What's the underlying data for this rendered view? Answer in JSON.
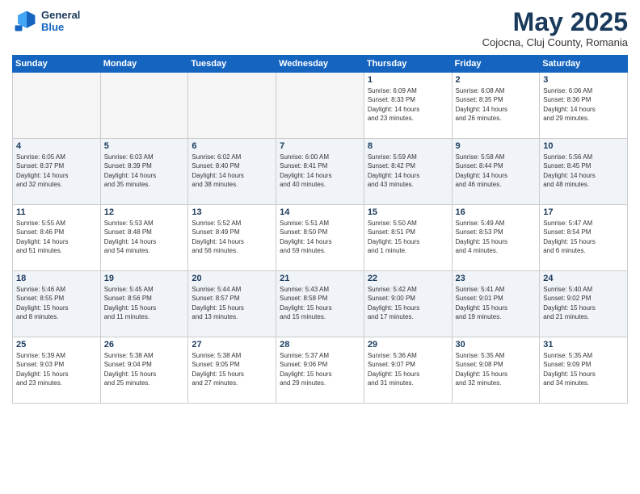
{
  "header": {
    "logo_line1": "General",
    "logo_line2": "Blue",
    "month": "May 2025",
    "location": "Cojocna, Cluj County, Romania"
  },
  "days_of_week": [
    "Sunday",
    "Monday",
    "Tuesday",
    "Wednesday",
    "Thursday",
    "Friday",
    "Saturday"
  ],
  "weeks": [
    [
      {
        "day": "",
        "info": "",
        "empty": true
      },
      {
        "day": "",
        "info": "",
        "empty": true
      },
      {
        "day": "",
        "info": "",
        "empty": true
      },
      {
        "day": "",
        "info": "",
        "empty": true
      },
      {
        "day": "1",
        "info": "Sunrise: 6:09 AM\nSunset: 8:33 PM\nDaylight: 14 hours\nand 23 minutes."
      },
      {
        "day": "2",
        "info": "Sunrise: 6:08 AM\nSunset: 8:35 PM\nDaylight: 14 hours\nand 26 minutes."
      },
      {
        "day": "3",
        "info": "Sunrise: 6:06 AM\nSunset: 8:36 PM\nDaylight: 14 hours\nand 29 minutes."
      }
    ],
    [
      {
        "day": "4",
        "info": "Sunrise: 6:05 AM\nSunset: 8:37 PM\nDaylight: 14 hours\nand 32 minutes."
      },
      {
        "day": "5",
        "info": "Sunrise: 6:03 AM\nSunset: 8:39 PM\nDaylight: 14 hours\nand 35 minutes."
      },
      {
        "day": "6",
        "info": "Sunrise: 6:02 AM\nSunset: 8:40 PM\nDaylight: 14 hours\nand 38 minutes."
      },
      {
        "day": "7",
        "info": "Sunrise: 6:00 AM\nSunset: 8:41 PM\nDaylight: 14 hours\nand 40 minutes."
      },
      {
        "day": "8",
        "info": "Sunrise: 5:59 AM\nSunset: 8:42 PM\nDaylight: 14 hours\nand 43 minutes."
      },
      {
        "day": "9",
        "info": "Sunrise: 5:58 AM\nSunset: 8:44 PM\nDaylight: 14 hours\nand 46 minutes."
      },
      {
        "day": "10",
        "info": "Sunrise: 5:56 AM\nSunset: 8:45 PM\nDaylight: 14 hours\nand 48 minutes."
      }
    ],
    [
      {
        "day": "11",
        "info": "Sunrise: 5:55 AM\nSunset: 8:46 PM\nDaylight: 14 hours\nand 51 minutes."
      },
      {
        "day": "12",
        "info": "Sunrise: 5:53 AM\nSunset: 8:48 PM\nDaylight: 14 hours\nand 54 minutes."
      },
      {
        "day": "13",
        "info": "Sunrise: 5:52 AM\nSunset: 8:49 PM\nDaylight: 14 hours\nand 56 minutes."
      },
      {
        "day": "14",
        "info": "Sunrise: 5:51 AM\nSunset: 8:50 PM\nDaylight: 14 hours\nand 59 minutes."
      },
      {
        "day": "15",
        "info": "Sunrise: 5:50 AM\nSunset: 8:51 PM\nDaylight: 15 hours\nand 1 minute."
      },
      {
        "day": "16",
        "info": "Sunrise: 5:49 AM\nSunset: 8:53 PM\nDaylight: 15 hours\nand 4 minutes."
      },
      {
        "day": "17",
        "info": "Sunrise: 5:47 AM\nSunset: 8:54 PM\nDaylight: 15 hours\nand 6 minutes."
      }
    ],
    [
      {
        "day": "18",
        "info": "Sunrise: 5:46 AM\nSunset: 8:55 PM\nDaylight: 15 hours\nand 8 minutes."
      },
      {
        "day": "19",
        "info": "Sunrise: 5:45 AM\nSunset: 8:56 PM\nDaylight: 15 hours\nand 11 minutes."
      },
      {
        "day": "20",
        "info": "Sunrise: 5:44 AM\nSunset: 8:57 PM\nDaylight: 15 hours\nand 13 minutes."
      },
      {
        "day": "21",
        "info": "Sunrise: 5:43 AM\nSunset: 8:58 PM\nDaylight: 15 hours\nand 15 minutes."
      },
      {
        "day": "22",
        "info": "Sunrise: 5:42 AM\nSunset: 9:00 PM\nDaylight: 15 hours\nand 17 minutes."
      },
      {
        "day": "23",
        "info": "Sunrise: 5:41 AM\nSunset: 9:01 PM\nDaylight: 15 hours\nand 19 minutes."
      },
      {
        "day": "24",
        "info": "Sunrise: 5:40 AM\nSunset: 9:02 PM\nDaylight: 15 hours\nand 21 minutes."
      }
    ],
    [
      {
        "day": "25",
        "info": "Sunrise: 5:39 AM\nSunset: 9:03 PM\nDaylight: 15 hours\nand 23 minutes."
      },
      {
        "day": "26",
        "info": "Sunrise: 5:38 AM\nSunset: 9:04 PM\nDaylight: 15 hours\nand 25 minutes."
      },
      {
        "day": "27",
        "info": "Sunrise: 5:38 AM\nSunset: 9:05 PM\nDaylight: 15 hours\nand 27 minutes."
      },
      {
        "day": "28",
        "info": "Sunrise: 5:37 AM\nSunset: 9:06 PM\nDaylight: 15 hours\nand 29 minutes."
      },
      {
        "day": "29",
        "info": "Sunrise: 5:36 AM\nSunset: 9:07 PM\nDaylight: 15 hours\nand 31 minutes."
      },
      {
        "day": "30",
        "info": "Sunrise: 5:35 AM\nSunset: 9:08 PM\nDaylight: 15 hours\nand 32 minutes."
      },
      {
        "day": "31",
        "info": "Sunrise: 5:35 AM\nSunset: 9:09 PM\nDaylight: 15 hours\nand 34 minutes."
      }
    ]
  ]
}
